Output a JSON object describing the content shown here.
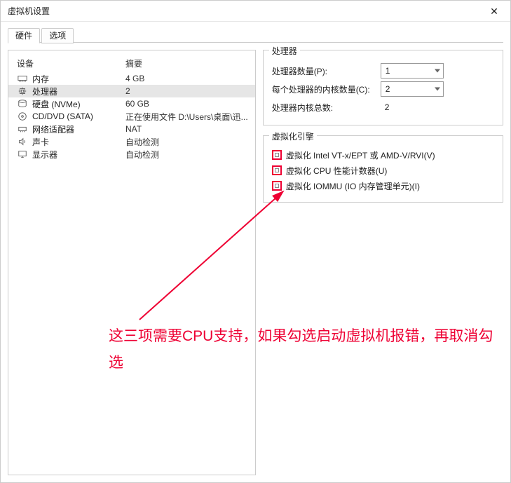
{
  "window": {
    "title": "虚拟机设置"
  },
  "tabs": {
    "hardware": "硬件",
    "options": "选项"
  },
  "hw_headers": {
    "device": "设备",
    "summary": "摘要"
  },
  "hw": [
    {
      "icon": "memory",
      "dev": "内存",
      "sum": "4 GB"
    },
    {
      "icon": "cpu",
      "dev": "处理器",
      "sum": "2"
    },
    {
      "icon": "disk",
      "dev": "硬盘 (NVMe)",
      "sum": "60 GB"
    },
    {
      "icon": "cd",
      "dev": "CD/DVD (SATA)",
      "sum": "正在使用文件 D:\\Users\\桌面\\迅..."
    },
    {
      "icon": "net",
      "dev": "网络适配器",
      "sum": "NAT"
    },
    {
      "icon": "sound",
      "dev": "声卡",
      "sum": "自动检测"
    },
    {
      "icon": "display",
      "dev": "显示器",
      "sum": "自动检测"
    }
  ],
  "proc": {
    "legend": "处理器",
    "num_label": "处理器数量(P):",
    "num_value": "1",
    "cores_label": "每个处理器的内核数量(C):",
    "cores_value": "2",
    "total_label": "处理器内核总数:",
    "total_value": "2"
  },
  "virt": {
    "legend": "虚拟化引擎",
    "opt1": "虚拟化 Intel VT-x/EPT 或 AMD-V/RVI(V)",
    "opt2": "虚拟化 CPU 性能计数器(U)",
    "opt3": "虚拟化 IOMMU (IO 内存管理单元)(I)"
  },
  "note": "这三项需要CPU支持，如果勾选启动虚拟机报错，再取消勾选"
}
